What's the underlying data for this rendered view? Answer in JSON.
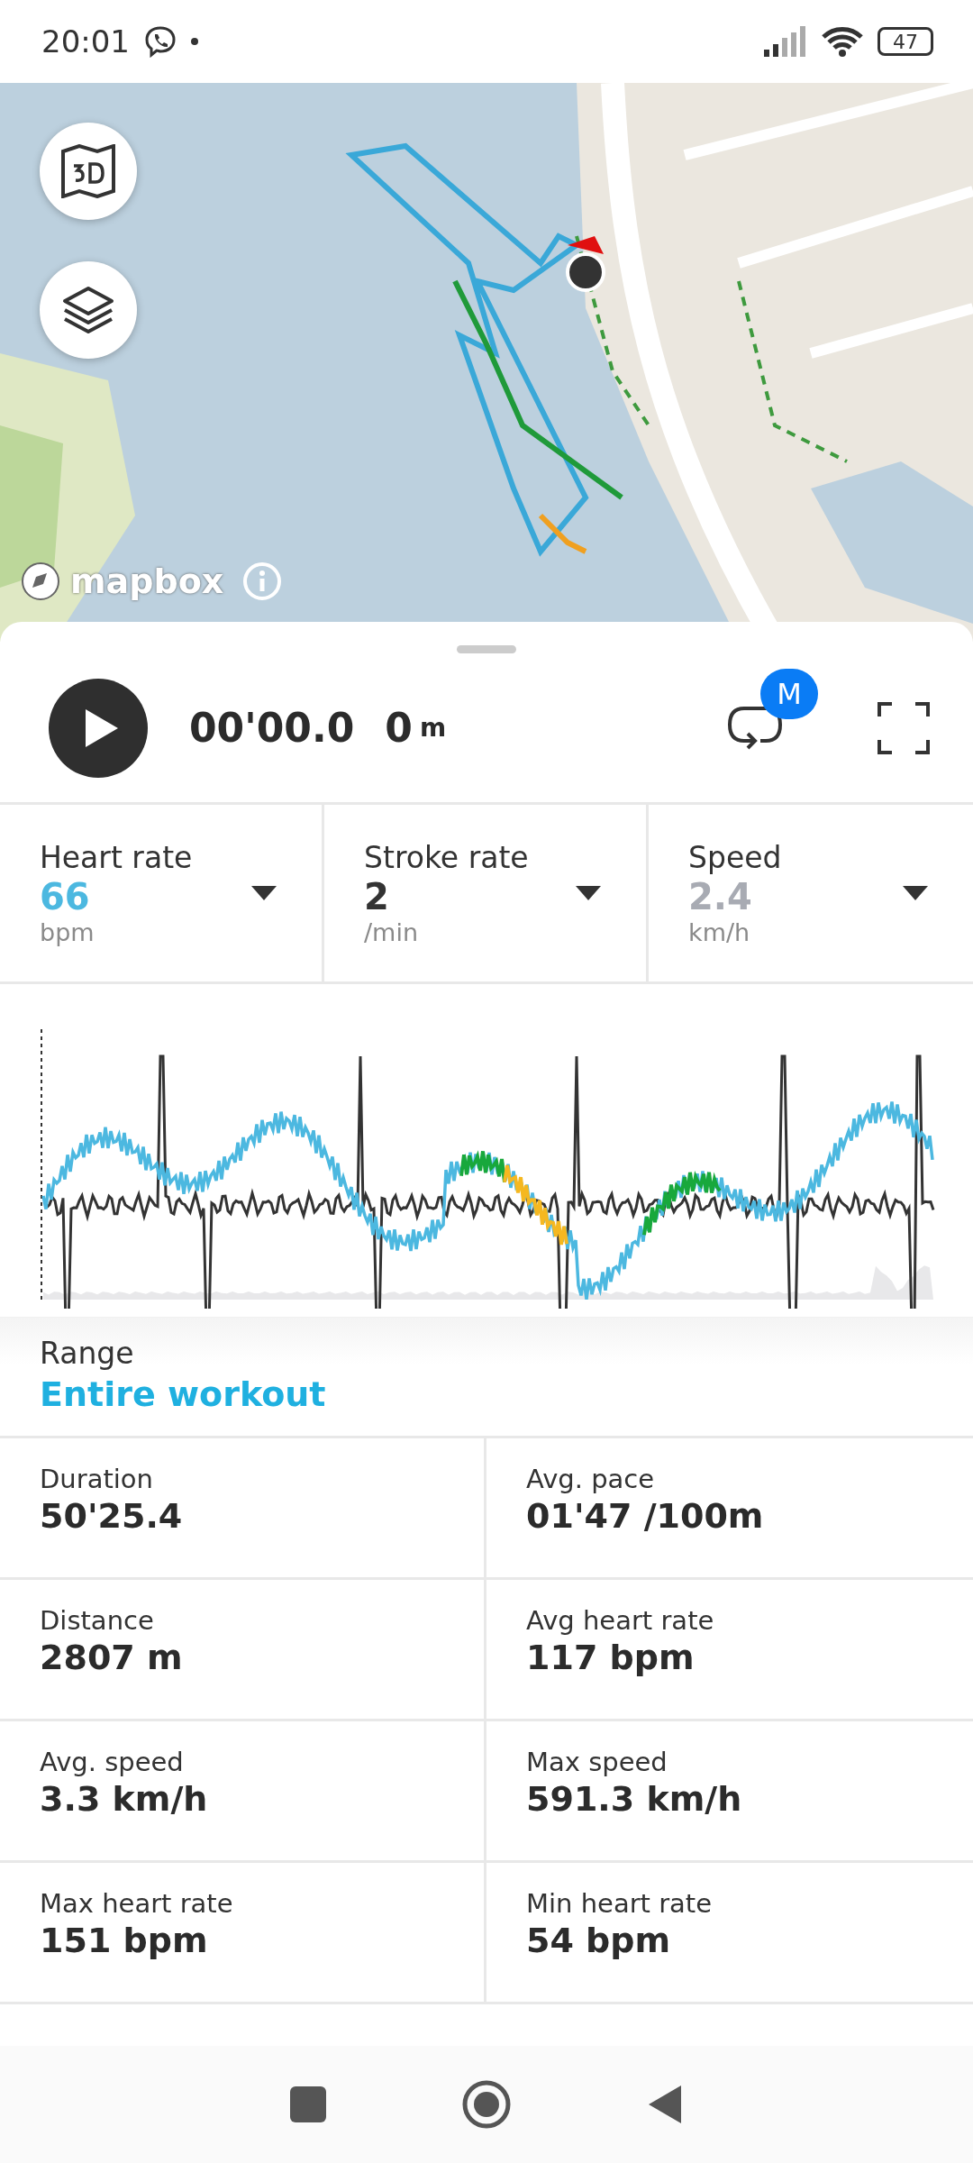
{
  "status_bar": {
    "time": "20:01",
    "battery": "47"
  },
  "map": {
    "attribution": "mapbox"
  },
  "player": {
    "elapsed": "00'00.0",
    "distance": "0",
    "distance_unit": "m",
    "badge": "M"
  },
  "metrics": [
    {
      "label": "Heart rate",
      "value": "66",
      "unit": "bpm",
      "color": "#4cb8e0"
    },
    {
      "label": "Stroke rate",
      "value": "2",
      "unit": "/min",
      "color": "#333333"
    },
    {
      "label": "Speed",
      "value": "2.4",
      "unit": "km/h",
      "color": "#a8abb3"
    }
  ],
  "range": {
    "label": "Range",
    "value": "Entire workout"
  },
  "stats": [
    {
      "label": "Duration",
      "value": "50'25.4"
    },
    {
      "label": "Avg. pace",
      "value": "01'47 /100m"
    },
    {
      "label": "Distance",
      "value": "2807 m"
    },
    {
      "label": "Avg heart rate",
      "value": "117 bpm"
    },
    {
      "label": "Avg. speed",
      "value": "3.3 km/h"
    },
    {
      "label": "Max speed",
      "value": "591.3 km/h"
    },
    {
      "label": "Max heart rate",
      "value": "151 bpm"
    },
    {
      "label": "Min heart rate",
      "value": "54 bpm"
    }
  ]
}
